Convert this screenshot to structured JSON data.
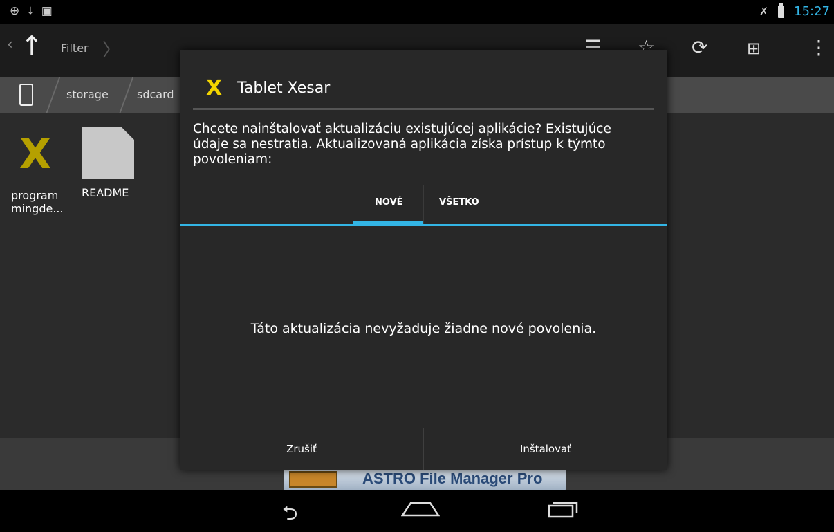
{
  "status": {
    "time": "15:27"
  },
  "appbar": {
    "filter_label": "Filter"
  },
  "breadcrumbs": [
    "storage",
    "sdcard"
  ],
  "files": [
    {
      "name": "program mingde...",
      "icon": "app-x-icon"
    },
    {
      "name": "README",
      "icon": "document-icon"
    }
  ],
  "dialog": {
    "app_icon": "X",
    "title": "Tablet Xesar",
    "message": "Chcete nainštalovať aktualizáciu existujúcej aplikácie? Existujúce údaje sa nestratia. Aktualizovaná aplikácia získa prístup k týmto povoleniam:",
    "tabs": {
      "new": "NOVÉ",
      "all": "VŠETKO"
    },
    "empty_text": "Táto aktualizácia nevyžaduje žiadne nové povolenia.",
    "cancel_label": "Zrušiť",
    "install_label": "Inštalovať"
  },
  "ad": {
    "text": "ASTRO File Manager Pro"
  },
  "colors": {
    "accent": "#33b5e5",
    "app_icon": "#f2d400"
  }
}
